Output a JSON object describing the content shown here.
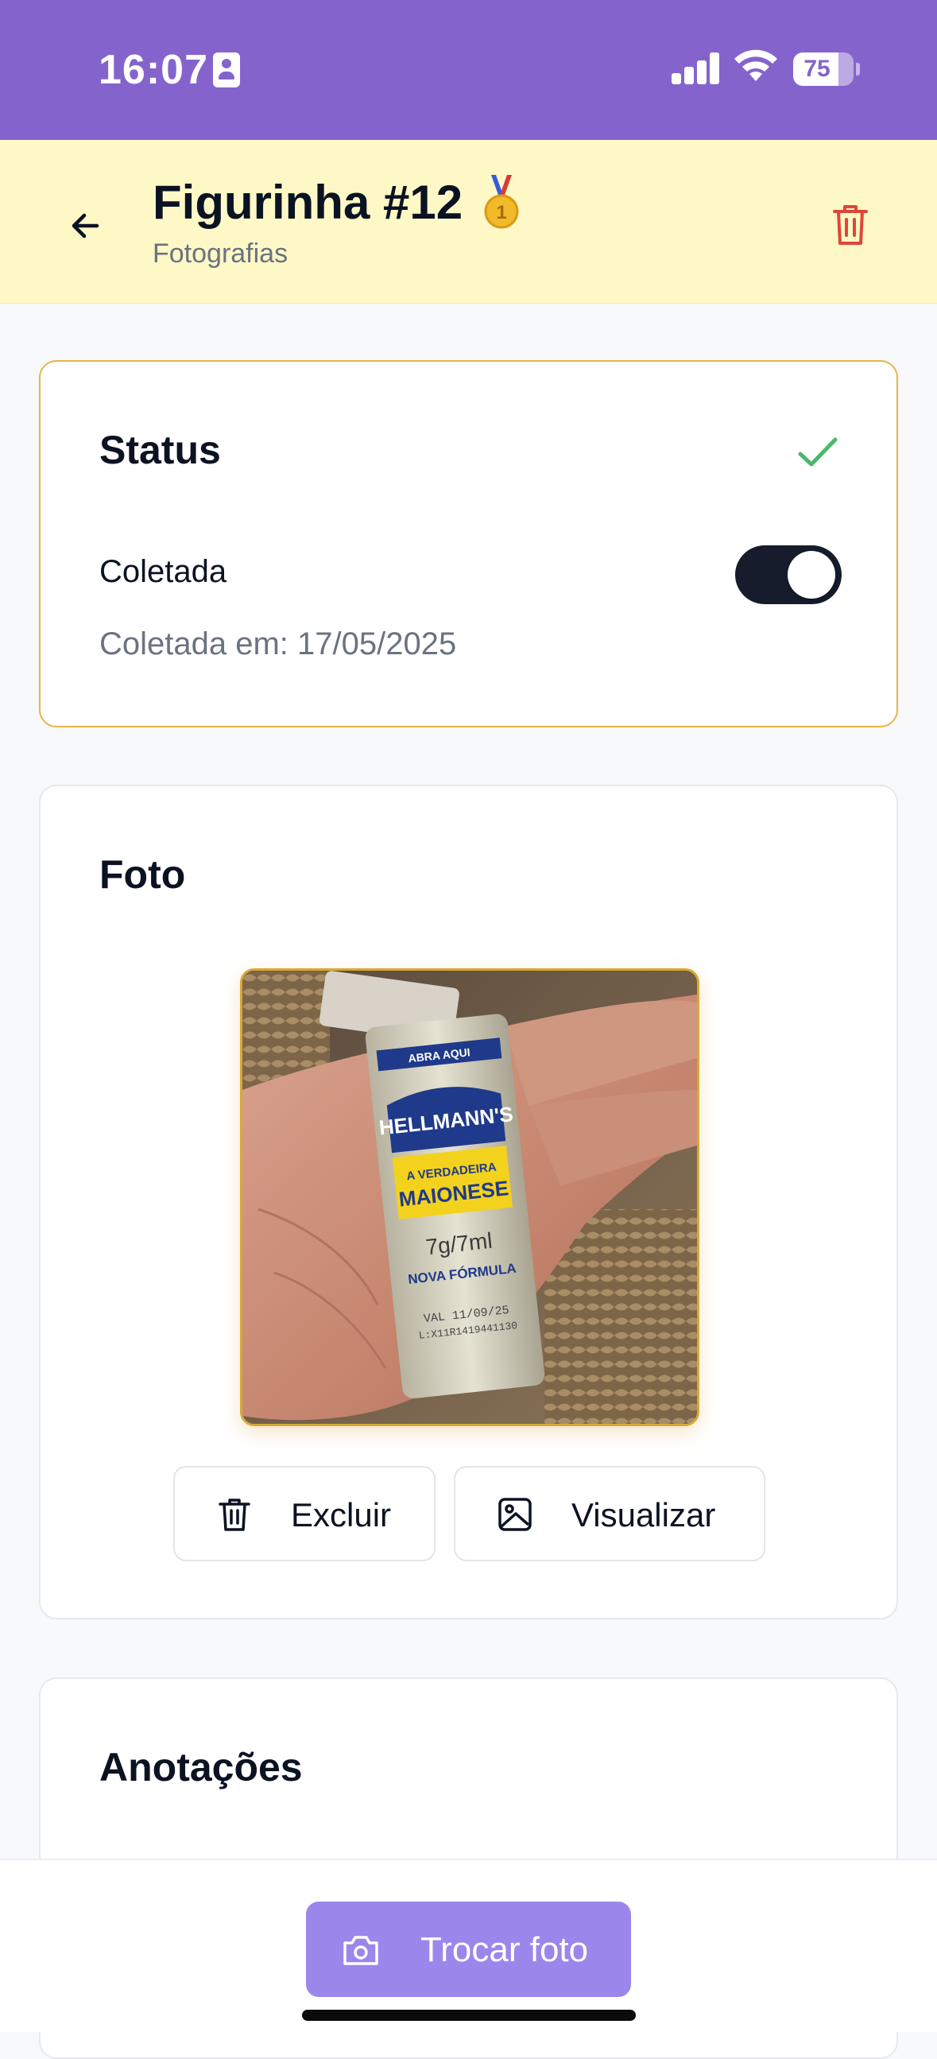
{
  "status_bar": {
    "time": "16:07",
    "battery": "75",
    "battery_level": 0.75,
    "icons": [
      "person-badge-icon",
      "signal-icon",
      "wifi-icon",
      "battery-icon"
    ]
  },
  "header": {
    "title": "Figurinha #12",
    "subtitle": "Fotografias",
    "icons": [
      "back-arrow-icon",
      "medal-icon",
      "trash-icon"
    ]
  },
  "status_card": {
    "title": "Status",
    "toggle_label": "Coletada",
    "toggle_on": true,
    "collected_text": "Coletada em: 17/05/2025"
  },
  "photo_card": {
    "title": "Foto",
    "delete_label": "Excluir",
    "view_label": "Visualizar"
  },
  "notes_card": {
    "title": "Anotações"
  },
  "bottom": {
    "change_photo_label": "Trocar foto"
  },
  "colors": {
    "status_bar": "#8464cc",
    "header_bg": "#fdf8c6",
    "accent_border": "#e7b546",
    "toggle_on": "#161c2b",
    "check": "#4cb86a",
    "danger": "#e0453a",
    "cta": "#9b86ec"
  }
}
